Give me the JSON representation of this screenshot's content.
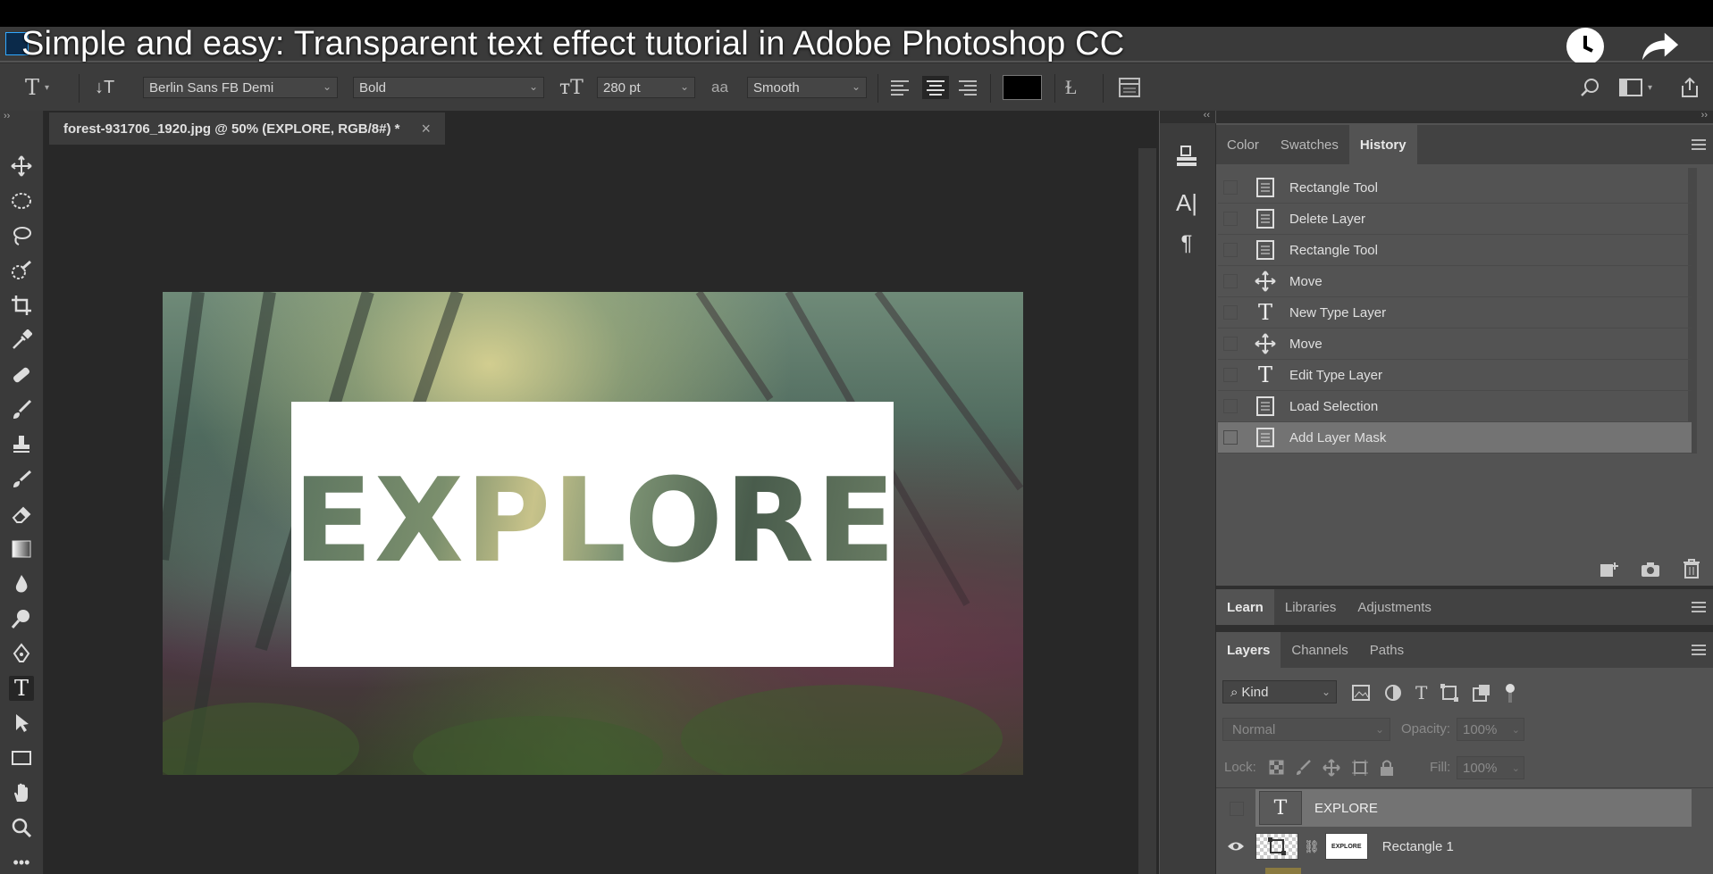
{
  "video": {
    "title": "Simple and easy: Transparent text effect tutorial in Adobe Photoshop CC"
  },
  "options_bar": {
    "font_family": "Berlin Sans FB Demi",
    "font_style": "Bold",
    "font_size": "280 pt",
    "anti_alias_glyph": "aa",
    "anti_alias": "Smooth",
    "text_color": "#000000"
  },
  "document": {
    "tab_title": "forest-931706_1920.jpg @ 50% (EXPLORE, RGB/8#) *",
    "close_glyph": "×",
    "canvas_text": "EXPLORE"
  },
  "history_panel": {
    "tabs": [
      {
        "label": "Color"
      },
      {
        "label": "Swatches"
      },
      {
        "label": "History"
      }
    ],
    "items": [
      {
        "label": "Rectangle Tool",
        "icon": "document-icon"
      },
      {
        "label": "Delete Layer",
        "icon": "document-icon"
      },
      {
        "label": "Rectangle Tool",
        "icon": "document-icon"
      },
      {
        "label": "Move",
        "icon": "move-icon"
      },
      {
        "label": "New Type Layer",
        "icon": "type-icon"
      },
      {
        "label": "Move",
        "icon": "move-icon"
      },
      {
        "label": "Edit Type Layer",
        "icon": "type-icon"
      },
      {
        "label": "Load Selection",
        "icon": "document-icon"
      },
      {
        "label": "Add Layer Mask",
        "icon": "document-icon"
      }
    ],
    "selected_index": 8
  },
  "learn_panel": {
    "tabs": [
      {
        "label": "Learn"
      },
      {
        "label": "Libraries"
      },
      {
        "label": "Adjustments"
      }
    ]
  },
  "layers_panel": {
    "tabs": [
      {
        "label": "Layers"
      },
      {
        "label": "Channels"
      },
      {
        "label": "Paths"
      }
    ],
    "filter_kind": "Kind",
    "blend_mode": "Normal",
    "opacity_label": "Opacity:",
    "opacity_value": "100%",
    "lock_label": "Lock:",
    "fill_label": "Fill:",
    "fill_value": "100%",
    "layers": [
      {
        "name": "EXPLORE",
        "type": "text"
      },
      {
        "name": "Rectangle 1",
        "type": "shape",
        "mask_text": "EXPLORE"
      }
    ]
  },
  "colors": {
    "panel_bg": "#535353",
    "history_selected": "#737373",
    "canvas_bg": "#282828"
  }
}
